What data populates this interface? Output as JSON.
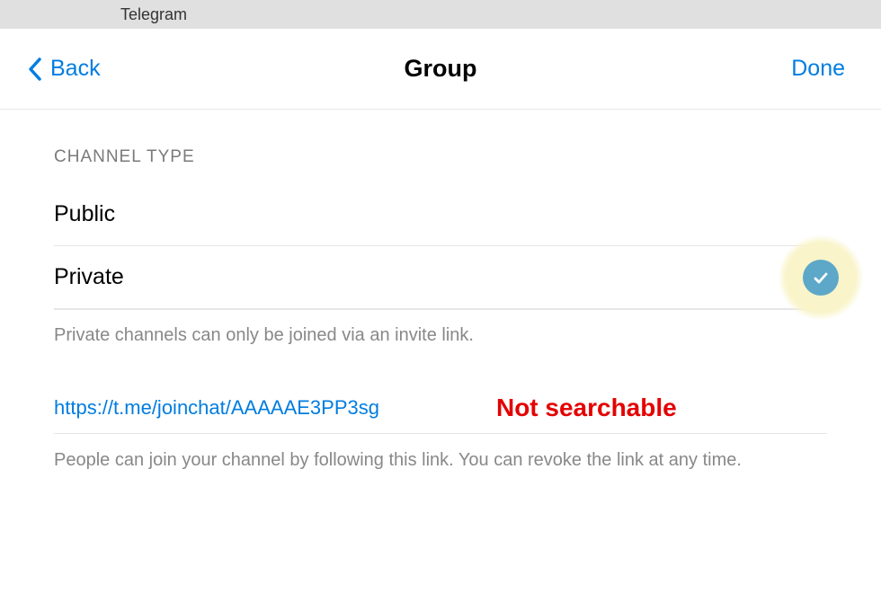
{
  "window": {
    "title": "Telegram"
  },
  "nav": {
    "back_label": "Back",
    "title": "Group",
    "done_label": "Done"
  },
  "section": {
    "header": "Channel Type",
    "options": {
      "public": "Public",
      "private": "Private"
    },
    "private_helper": "Private channels can only be joined via an invite link."
  },
  "link": {
    "url": "https://t.me/joinchat/AAAAAE3PP3sg",
    "helper": "People can join your channel by following this link. You can revoke the link at any time."
  },
  "annotation": {
    "not_searchable": "Not searchable"
  }
}
